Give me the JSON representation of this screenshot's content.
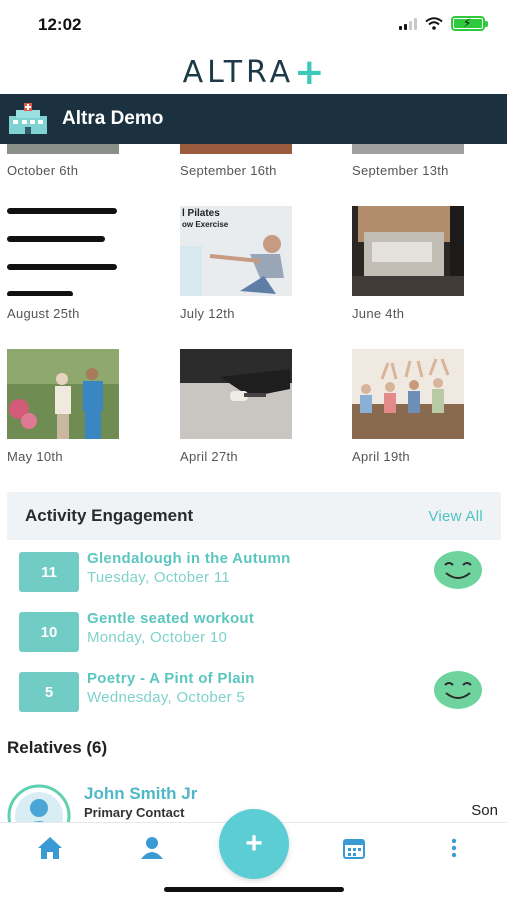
{
  "status_bar": {
    "time": "12:02"
  },
  "brand": {
    "logo_text": "ALTRA",
    "logo_plus": "+"
  },
  "header": {
    "title": "Altra Demo"
  },
  "gallery": {
    "top_row_dates": [
      "October 6th",
      "September 16th",
      "September 13th"
    ],
    "tiles": [
      {
        "date": "August 25th",
        "kind": "text-lines"
      },
      {
        "date": "July 12th",
        "kind": "pilates",
        "overlay_line1": "l Pilates",
        "overlay_line2": "ow Exercise"
      },
      {
        "date": "June 4th",
        "kind": "photo"
      },
      {
        "date": "May 10th",
        "kind": "photo"
      },
      {
        "date": "April 27th",
        "kind": "photo"
      },
      {
        "date": "April 19th",
        "kind": "photo"
      }
    ]
  },
  "engagement": {
    "title": "Activity Engagement",
    "view_all": "View All",
    "items": [
      {
        "badge": "11",
        "name": "Glendalough in the Autumn",
        "date": "Tuesday, October 11",
        "reaction": "happy-face-icon"
      },
      {
        "badge": "10",
        "name": "Gentle seated workout",
        "date": "Monday, October 10",
        "reaction": ""
      },
      {
        "badge": "5",
        "name": "Poetry - A Pint of Plain",
        "date": "Wednesday, October 5",
        "reaction": "happy-face-icon"
      }
    ]
  },
  "relatives": {
    "title": "Relatives (6)",
    "items": [
      {
        "name": "John Smith Jr",
        "role": "Primary Contact",
        "relation": "Son"
      }
    ]
  },
  "tabs": [
    "home-icon",
    "person-icon",
    "add-icon",
    "calendar-icon",
    "more-icon"
  ],
  "colors": {
    "header_bg": "#1b3140",
    "accent": "#5cc6bf",
    "badge": "#70ccc4",
    "fab": "#5ccdd4",
    "smiley": "#6fd39e"
  }
}
